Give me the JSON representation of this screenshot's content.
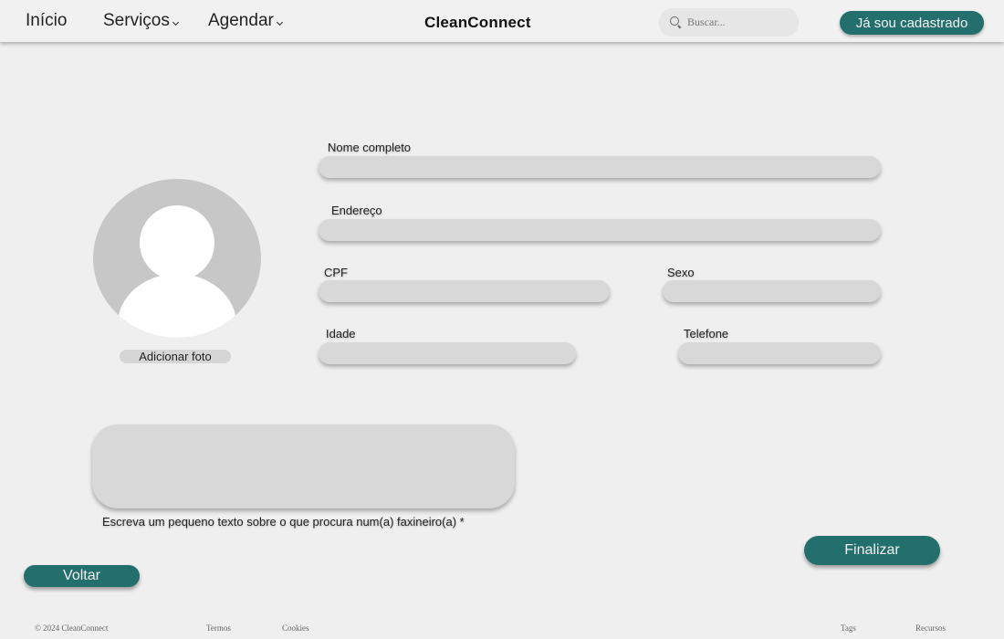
{
  "header": {
    "nav": [
      {
        "label": "Início",
        "has_dropdown": false
      },
      {
        "label": "Serviços",
        "has_dropdown": true
      },
      {
        "label": "Agendar",
        "has_dropdown": true
      }
    ],
    "brand": "CleanConnect",
    "search": {
      "placeholder": "Buscar...",
      "value": "",
      "icon": "search-icon"
    },
    "login_button": "Já sou cadastrado"
  },
  "profile": {
    "avatar_icon": "user-placeholder-icon",
    "add_photo_label": "Adicionar foto"
  },
  "form": {
    "fields": {
      "full_name": {
        "label": "Nome completo",
        "value": ""
      },
      "address": {
        "label": "Endereço",
        "value": ""
      },
      "cpf": {
        "label": "CPF",
        "value": ""
      },
      "sex": {
        "label": "Sexo",
        "value": ""
      },
      "age": {
        "label": "Idade",
        "value": ""
      },
      "phone": {
        "label": "Telefone",
        "value": ""
      }
    },
    "description": {
      "value": "",
      "helper": "Escreva um pequeno texto sobre o que procura num(a) faxineiro(a) *"
    },
    "finalize_label": "Finalizar",
    "back_label": "Voltar"
  },
  "footer": {
    "copyright": "© 2024 CleanConnect",
    "links": [
      "Termos",
      "Cookies",
      "Tags",
      "Recursos"
    ]
  },
  "colors": {
    "accent": "#236f6d",
    "background": "#efefef",
    "field": "#d8d8d8",
    "avatar": "#c7c7c7"
  }
}
